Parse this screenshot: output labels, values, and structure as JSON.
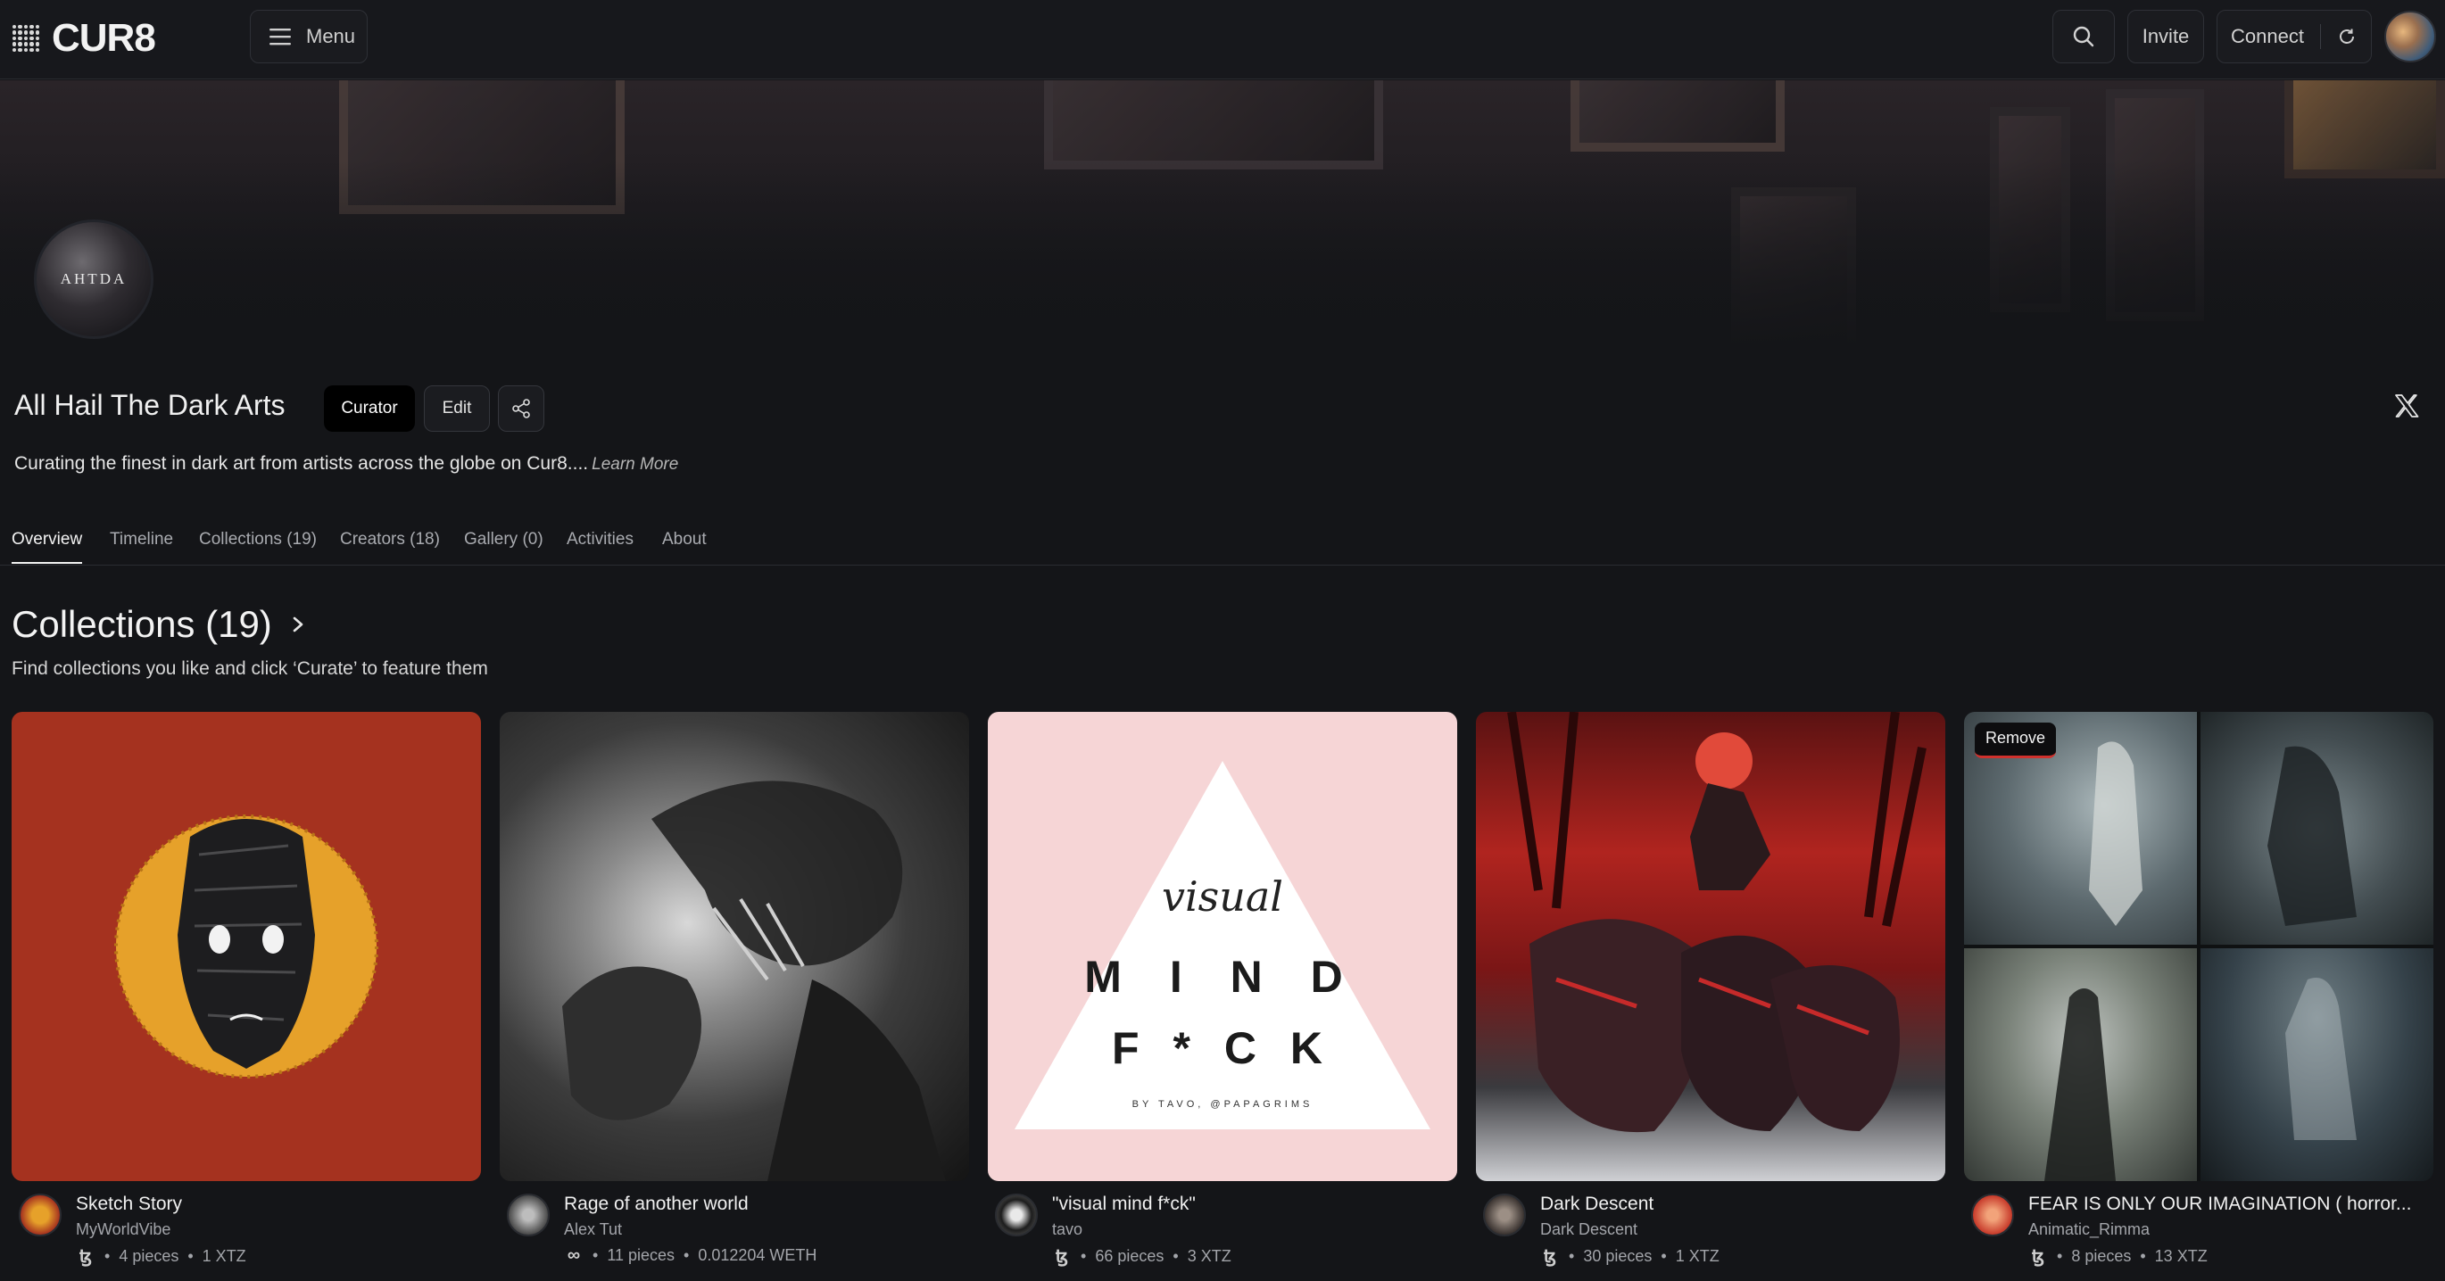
{
  "app": {
    "logo_text": "CUR8"
  },
  "topbar": {
    "menu_label": "Menu",
    "invite_label": "Invite",
    "connect_label": "Connect",
    "icons": [
      "search-icon",
      "refresh-icon",
      "hamburger-icon"
    ]
  },
  "profile": {
    "avatar_text": "AHTDA",
    "name": "All Hail The Dark Arts",
    "curator_label": "Curator",
    "edit_label": "Edit",
    "description": "Curating the finest in dark art from artists across the globe on Cur8....",
    "learn_more": "Learn More"
  },
  "tabs": [
    {
      "label": "Overview",
      "active": true
    },
    {
      "label": "Timeline",
      "active": false
    },
    {
      "label": "Collections (19)",
      "active": false
    },
    {
      "label": "Creators (18)",
      "active": false
    },
    {
      "label": "Gallery (0)",
      "active": false
    },
    {
      "label": "Activities",
      "active": false
    },
    {
      "label": "About",
      "active": false
    }
  ],
  "collections": {
    "title": "Collections (19)",
    "subtitle": "Find collections you like and click ‘Curate’ to feature them",
    "remove_label": "Remove",
    "cards": [
      {
        "title": "Sketch Story",
        "creator": "MyWorldVibe",
        "currency_icon": "ꜩ",
        "pieces": "4 pieces",
        "price": "1 XTZ"
      },
      {
        "title": "Rage of another world",
        "creator": "Alex Tut",
        "currency_icon": "∞",
        "pieces": "11 pieces",
        "price": "0.012204 WETH"
      },
      {
        "title": "\"visual mind f*ck\"",
        "creator": "tavo",
        "currency_icon": "ꜩ",
        "pieces": "66 pieces",
        "price": "3 XTZ",
        "art_script": "visual",
        "art_line1": "M I N D",
        "art_line2": "F * C K",
        "art_byline": "BY TAVO, @PAPAGRIMS"
      },
      {
        "title": "Dark Descent",
        "creator": "Dark Descent",
        "currency_icon": "ꜩ",
        "pieces": "30 pieces",
        "price": "1 XTZ"
      },
      {
        "title": "FEAR IS ONLY OUR IMAGINATION ( horror...",
        "creator": "Animatic_Rimma",
        "currency_icon": "ꜩ",
        "pieces": "8 pieces",
        "price": "13 XTZ"
      }
    ]
  },
  "colors": {
    "background": "#141518",
    "accent_remove": "#d0312d",
    "sketch_bg": "#a5321f",
    "sketch_halo": "#e6a12a",
    "visual_bg": "#f6d5d6"
  }
}
